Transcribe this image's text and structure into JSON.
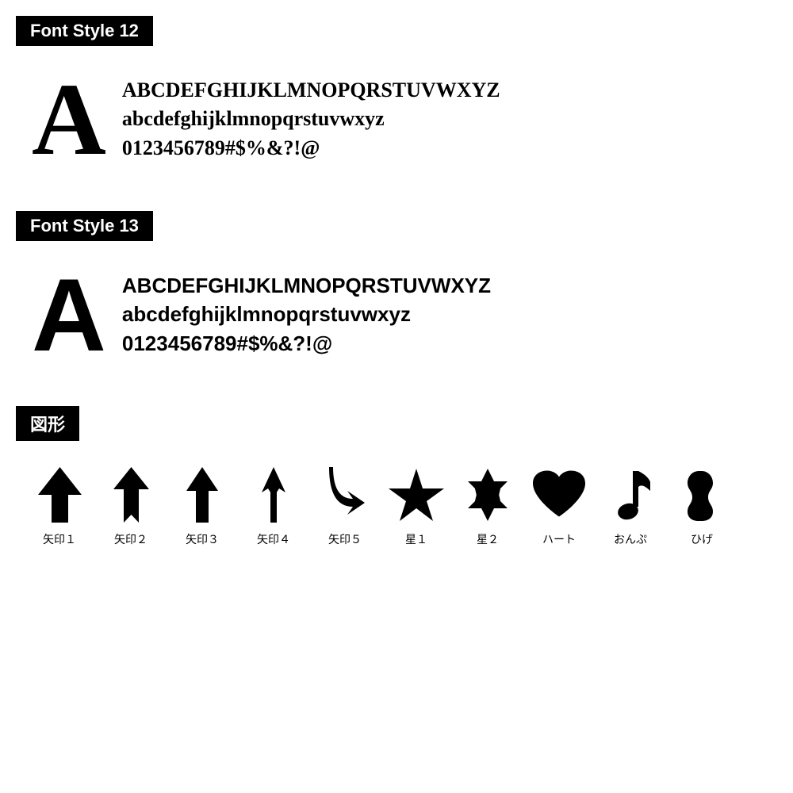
{
  "sections": [
    {
      "id": "font-style-12",
      "header": "Font Style 12",
      "big_letter": "A",
      "lines": [
        "ABCDEFGHIJKLMNOPQRSTUVWXYZ",
        "abcdefghijklmnopqrstuvwxyz",
        "0123456789#$%&?!@"
      ],
      "font_type": "serif"
    },
    {
      "id": "font-style-13",
      "header": "Font Style 13",
      "big_letter": "A",
      "lines": [
        "ABCDEFGHIJKLMNOPQRSTUVWXYZ",
        "abcdefghijklmnopqrstuvwxyz",
        "0123456789#$%&?!@"
      ],
      "font_type": "sans-serif"
    }
  ],
  "shapes_section": {
    "header": "図形",
    "items": [
      {
        "id": "arrow1",
        "label": "矢印１"
      },
      {
        "id": "arrow2",
        "label": "矢印２"
      },
      {
        "id": "arrow3",
        "label": "矢印３"
      },
      {
        "id": "arrow4",
        "label": "矢印４"
      },
      {
        "id": "arrow5",
        "label": "矢印５"
      },
      {
        "id": "star1",
        "label": "星１"
      },
      {
        "id": "star2",
        "label": "星２"
      },
      {
        "id": "heart",
        "label": "ハート"
      },
      {
        "id": "music",
        "label": "おんぷ"
      },
      {
        "id": "mustache",
        "label": "ひげ"
      }
    ]
  }
}
